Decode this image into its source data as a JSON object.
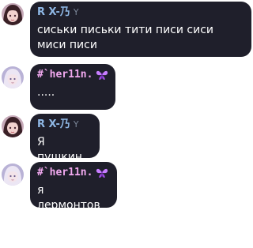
{
  "messages": [
    {
      "author": "R X-乃",
      "badge": "Y",
      "text": "сиськи письки тити писи сиси миси писи"
    },
    {
      "author": "#`her11n.",
      "badge": "",
      "text": "....."
    },
    {
      "author": "R X-乃",
      "badge": "Y",
      "text": "Я пушкин"
    },
    {
      "author": "#`her11n.",
      "badge": "",
      "text": "я лермонтов"
    }
  ],
  "icons": {
    "butterfly": "butterfly-icon",
    "avatar_dark_hair": "avatar-dark-hair",
    "avatar_light_hair": "avatar-light-hair"
  },
  "colors": {
    "bubble_bg": "#1f1f2b",
    "name_blue": "#8fb8e6",
    "name_pink": "#f2a9f0",
    "butterfly": "#c77dff"
  }
}
